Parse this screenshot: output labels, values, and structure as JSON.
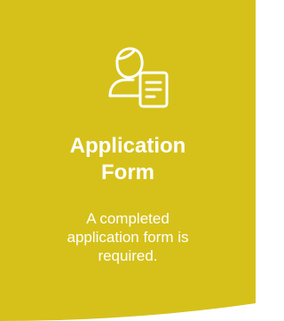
{
  "card": {
    "background_color": "#d6c11a",
    "text_color": "#ffffff",
    "icon": "person-with-form-icon",
    "title_line1": "Application",
    "title_line2": "Form",
    "description_line1": "A completed",
    "description_line2": "application form is",
    "description_line3": "required."
  }
}
